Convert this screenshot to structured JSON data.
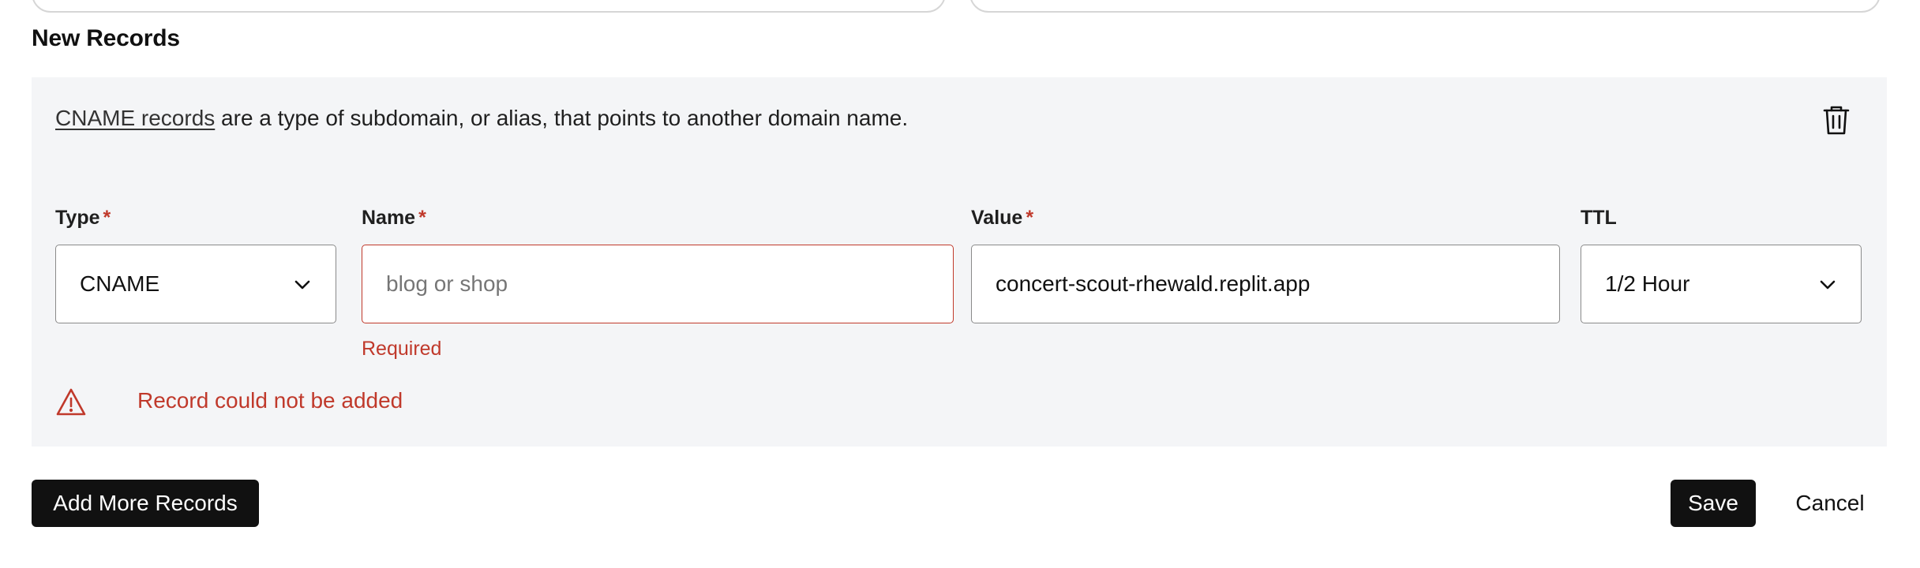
{
  "section": {
    "title": "New Records"
  },
  "record": {
    "description_link": "CNAME records",
    "description_rest": " are a type of subdomain, or alias, that points to another domain name.",
    "fields": {
      "type": {
        "label": "Type",
        "required_mark": "*",
        "value": "CNAME"
      },
      "name": {
        "label": "Name",
        "required_mark": "*",
        "value": "",
        "placeholder": "blog or shop",
        "error": "Required"
      },
      "value": {
        "label": "Value",
        "required_mark": "*",
        "value": "concert-scout-rhewald.replit.app"
      },
      "ttl": {
        "label": "TTL",
        "value": "1/2 Hour"
      }
    },
    "error_message": "Record could not be added"
  },
  "actions": {
    "add_more": "Add More Records",
    "save": "Save",
    "cancel": "Cancel"
  },
  "icons": {
    "delete": "trash-icon",
    "warning": "warning-triangle-icon",
    "dropdown": "chevron-down-icon"
  },
  "colors": {
    "error": "#c0392b",
    "panel_bg": "#f4f5f7",
    "button_dark": "#111111"
  }
}
